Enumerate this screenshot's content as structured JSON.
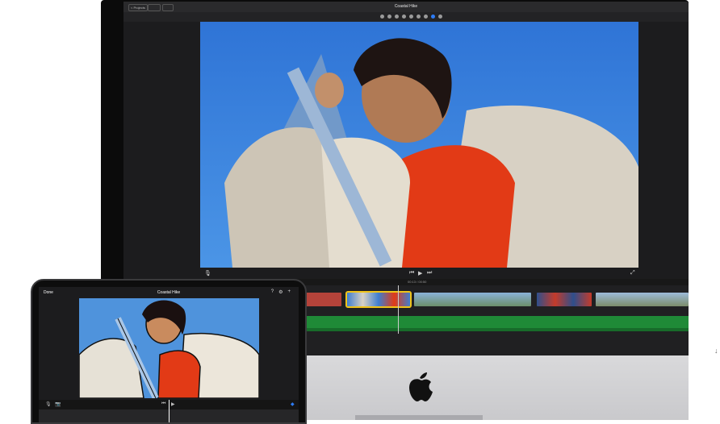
{
  "mac": {
    "title": "Coastal Hike",
    "projects_button": "< Projects",
    "timecode": "00:13 / 00:50",
    "transport": {
      "prev": "⏮",
      "play": "▶",
      "next": "⏭"
    }
  },
  "ipad": {
    "done_label": "Done",
    "title": "Coastal Hike",
    "icons": {
      "help": "?",
      "settings": "⚙",
      "add": "+"
    },
    "transport": {
      "prev": "⏮",
      "play": "▶"
    }
  },
  "colors": {
    "sky": "#3f86df",
    "sweater": "#e23a16",
    "jacket": "#d8d1c4",
    "audio": "#1f8a37",
    "accent": "#2d7cf6"
  }
}
